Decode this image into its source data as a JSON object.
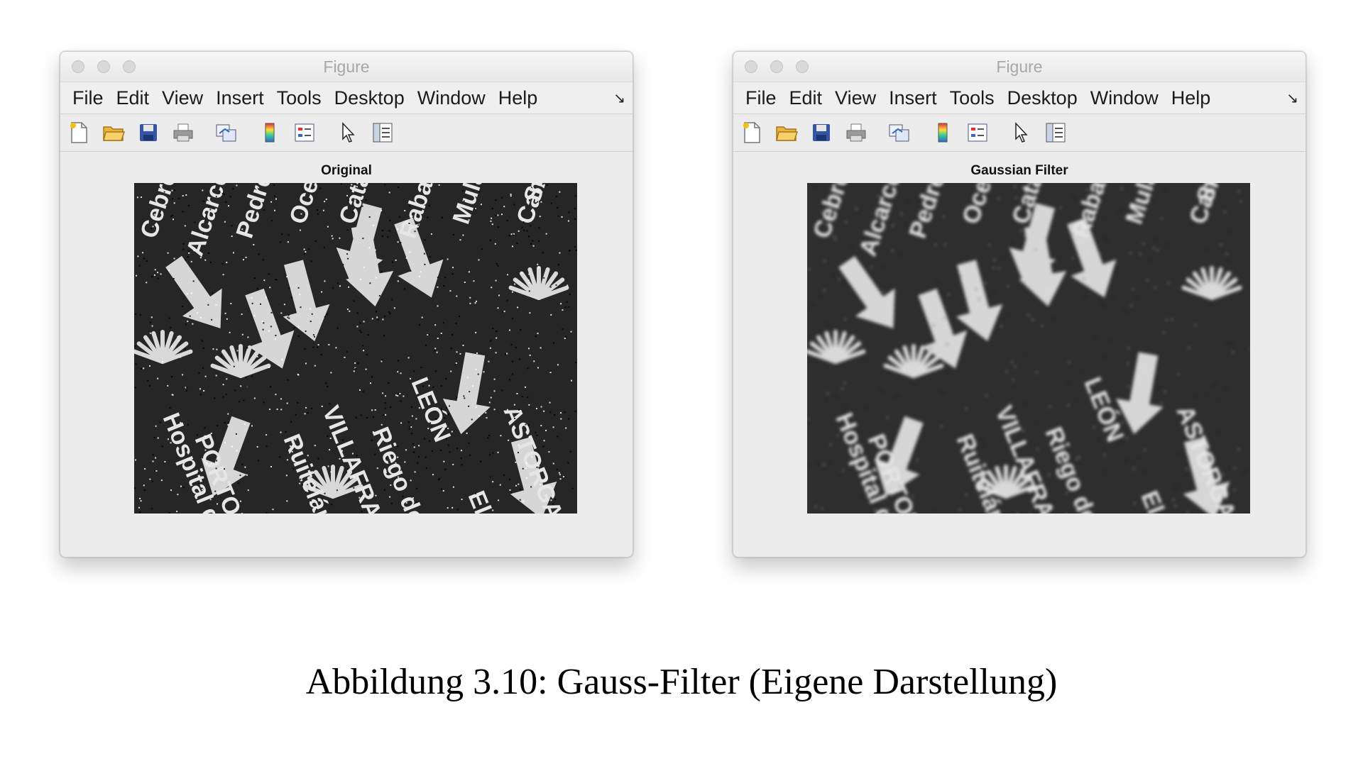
{
  "figures": [
    {
      "window_title": "Figure",
      "menu": [
        "File",
        "Edit",
        "View",
        "Insert",
        "Tools",
        "Desktop",
        "Window",
        "Help"
      ],
      "axes_title": "Original",
      "image_variant": "noisy"
    },
    {
      "window_title": "Figure",
      "menu": [
        "File",
        "Edit",
        "View",
        "Insert",
        "Tools",
        "Desktop",
        "Window",
        "Help"
      ],
      "axes_title": "Gaussian Filter",
      "image_variant": "blurred"
    }
  ],
  "toolbar_icons": [
    "new-file-icon",
    "open-folder-icon",
    "save-icon",
    "print-icon",
    "link-plot-icon",
    "colorbar-icon",
    "legend-icon",
    "pointer-icon",
    "property-editor-icon"
  ],
  "menu_overflow_glyph": "↘",
  "image_words": [
    "Cebreiro",
    "Alcarce",
    "Pedrelos",
    "Ocebo",
    "Catalina de Somoza",
    "Rabanal",
    "Mulas",
    "Camino",
    "SAMOS",
    "PORTOMARIN",
    "Hospital del",
    "Ruitelán",
    "VILLAFRANCA DEL",
    "Riego deAmbrós",
    "LEÓN",
    "ASTORGA",
    "El Ganso"
  ],
  "caption": "Abbildung 3.10: Gauss-Filter (Eigene Darstellung)"
}
